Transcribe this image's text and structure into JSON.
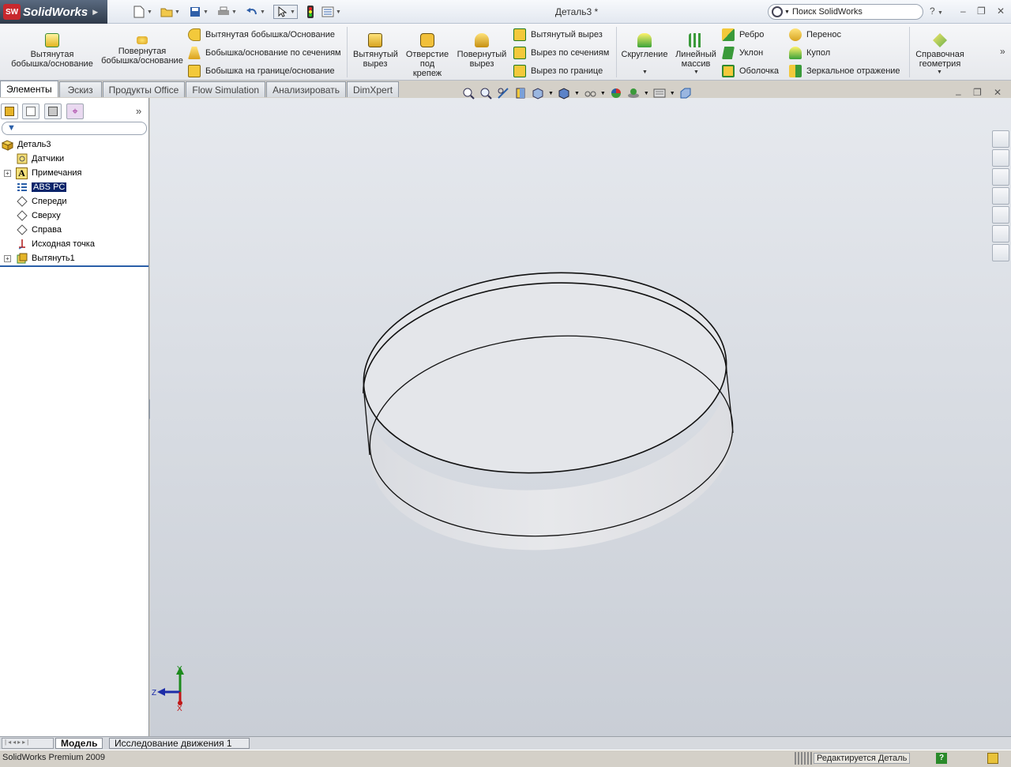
{
  "app": {
    "brand": "SolidWorks",
    "document_title": "Деталь3 *",
    "search_placeholder": "Поиск SolidWorks",
    "help_label": "?"
  },
  "commands": {
    "extrude_boss": "Вытянутая бобышка/основание",
    "revolve_boss": "Повернутая бобышка/основание",
    "extrude_boss_small": "Вытянутая бобышка/Основание",
    "loft_boss": "Бобышка/основание по сечениям",
    "boundary_boss": "Бобышка на границе/основание",
    "extrude_cut": "Вытянутый вырез",
    "hole_wizard": "Отверстие под крепеж",
    "revolve_cut": "Повернутый вырез",
    "extrude_cut_small": "Вытянутый вырез",
    "loft_cut": "Вырез по сечениям",
    "boundary_cut": "Вырез по границе",
    "fillet": "Скругление",
    "linear_pattern": "Линейный массив",
    "rib": "Ребро",
    "draft": "Уклон",
    "shell": "Оболочка",
    "wrap": "Перенос",
    "dome": "Купол",
    "mirror": "Зеркальное отражение",
    "ref_geometry": "Справочная геометрия"
  },
  "tabs": [
    "Элементы",
    "Эскиз",
    "Продукты Office",
    "Flow Simulation",
    "Анализировать",
    "DimXpert"
  ],
  "feature_tree": {
    "root": "Деталь3",
    "items": [
      "Датчики",
      "Примечания",
      "ABS PC",
      "Спереди",
      "Сверху",
      "Справа",
      "Исходная точка",
      "Вытянуть1"
    ]
  },
  "triad": {
    "x": "X",
    "y": "Y",
    "z": "Z"
  },
  "bottom_tabs": [
    "Модель",
    "Исследование движения 1"
  ],
  "status": {
    "product": "SolidWorks Premium 2009",
    "state": "Редактируется Деталь"
  },
  "colors": {
    "selection": "#0a246a",
    "viewport_top": "#e6e9ee",
    "viewport_bottom": "#c9ced6"
  }
}
